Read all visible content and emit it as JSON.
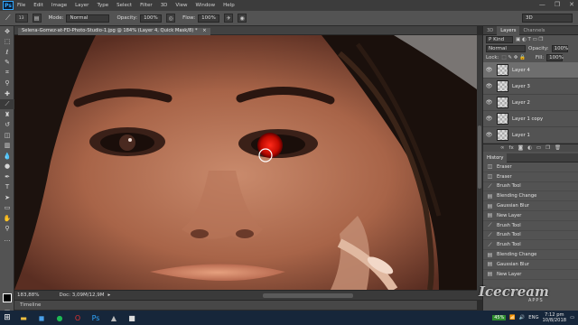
{
  "app": {
    "logo": "Ps"
  },
  "menu": [
    "File",
    "Edit",
    "Image",
    "Layer",
    "Type",
    "Select",
    "Filter",
    "3D",
    "View",
    "Window",
    "Help"
  ],
  "window_controls": [
    "—",
    "❐",
    "✕"
  ],
  "options": {
    "brush_size": "13",
    "mode_label": "Mode:",
    "mode_value": "Normal",
    "opacity_label": "Opacity:",
    "opacity_value": "100%",
    "flow_label": "Flow:",
    "flow_value": "100%",
    "workspace": "3D"
  },
  "document": {
    "title": "Selena-Gomez-at-FD-Photo-Studio-1.jpg @ 184% (Layer 4, Quick Mask/8) *",
    "close": "×"
  },
  "status": {
    "zoom": "183,88%",
    "doc": "Doc: 3,09M/12,9M"
  },
  "timeline": {
    "label": "Timeline"
  },
  "layers_panel": {
    "tabs": [
      "3D",
      "Layers",
      "Channels"
    ],
    "kind": "P Kind",
    "blend_mode": "Normal",
    "opacity_label": "Opacity:",
    "opacity_value": "100%",
    "lock_label": "Lock:",
    "fill_label": "Fill:",
    "fill_value": "100%",
    "layers": [
      {
        "name": "Layer 4",
        "selected": true
      },
      {
        "name": "Layer 3",
        "selected": false
      },
      {
        "name": "Layer 2",
        "selected": false
      },
      {
        "name": "Layer 1 copy",
        "selected": false
      },
      {
        "name": "Layer 1",
        "selected": false
      }
    ],
    "footer_icons": [
      "link-icon",
      "fx-icon",
      "mask-icon",
      "adjustment-icon",
      "group-icon",
      "new-layer-icon",
      "trash-icon"
    ]
  },
  "history_panel": {
    "title": "History",
    "items": [
      {
        "label": "Eraser",
        "icon": "eraser"
      },
      {
        "label": "Eraser",
        "icon": "eraser"
      },
      {
        "label": "Brush Tool",
        "icon": "brush"
      },
      {
        "label": "Blending Change",
        "icon": "doc"
      },
      {
        "label": "Gaussian Blur",
        "icon": "doc"
      },
      {
        "label": "New Layer",
        "icon": "doc"
      },
      {
        "label": "Brush Tool",
        "icon": "brush"
      },
      {
        "label": "Brush Tool",
        "icon": "brush"
      },
      {
        "label": "Brush Tool",
        "icon": "brush"
      },
      {
        "label": "Blending Change",
        "icon": "doc"
      },
      {
        "label": "Gaussian Blur",
        "icon": "doc"
      },
      {
        "label": "New Layer",
        "icon": "doc"
      }
    ]
  },
  "taskbar": {
    "apps": [
      {
        "name": "explorer",
        "glyph": "▬",
        "color": "#f0c040"
      },
      {
        "name": "store",
        "glyph": "◼",
        "color": "#4aa0e8"
      },
      {
        "name": "spotify",
        "glyph": "●",
        "color": "#1db954"
      },
      {
        "name": "opera",
        "glyph": "O",
        "color": "#e03030"
      },
      {
        "name": "photoshop",
        "glyph": "Ps",
        "color": "#31a8ff"
      },
      {
        "name": "photos",
        "glyph": "▲",
        "color": "#bbbbbb"
      },
      {
        "name": "app7",
        "glyph": "■",
        "color": "#dddddd"
      }
    ],
    "battery": "45%",
    "language": "ENG",
    "time": "7:12 pm",
    "date": "10/8/2018"
  },
  "watermark": {
    "brand": "Icecream",
    "sub": "APPS"
  },
  "tools": [
    "move",
    "marquee",
    "lasso",
    "quick-select",
    "crop",
    "eyedropper",
    "heal",
    "brush",
    "stamp",
    "history-brush",
    "eraser",
    "gradient",
    "blur",
    "dodge",
    "pen",
    "type",
    "path-select",
    "shape",
    "hand",
    "zoom",
    "more"
  ]
}
